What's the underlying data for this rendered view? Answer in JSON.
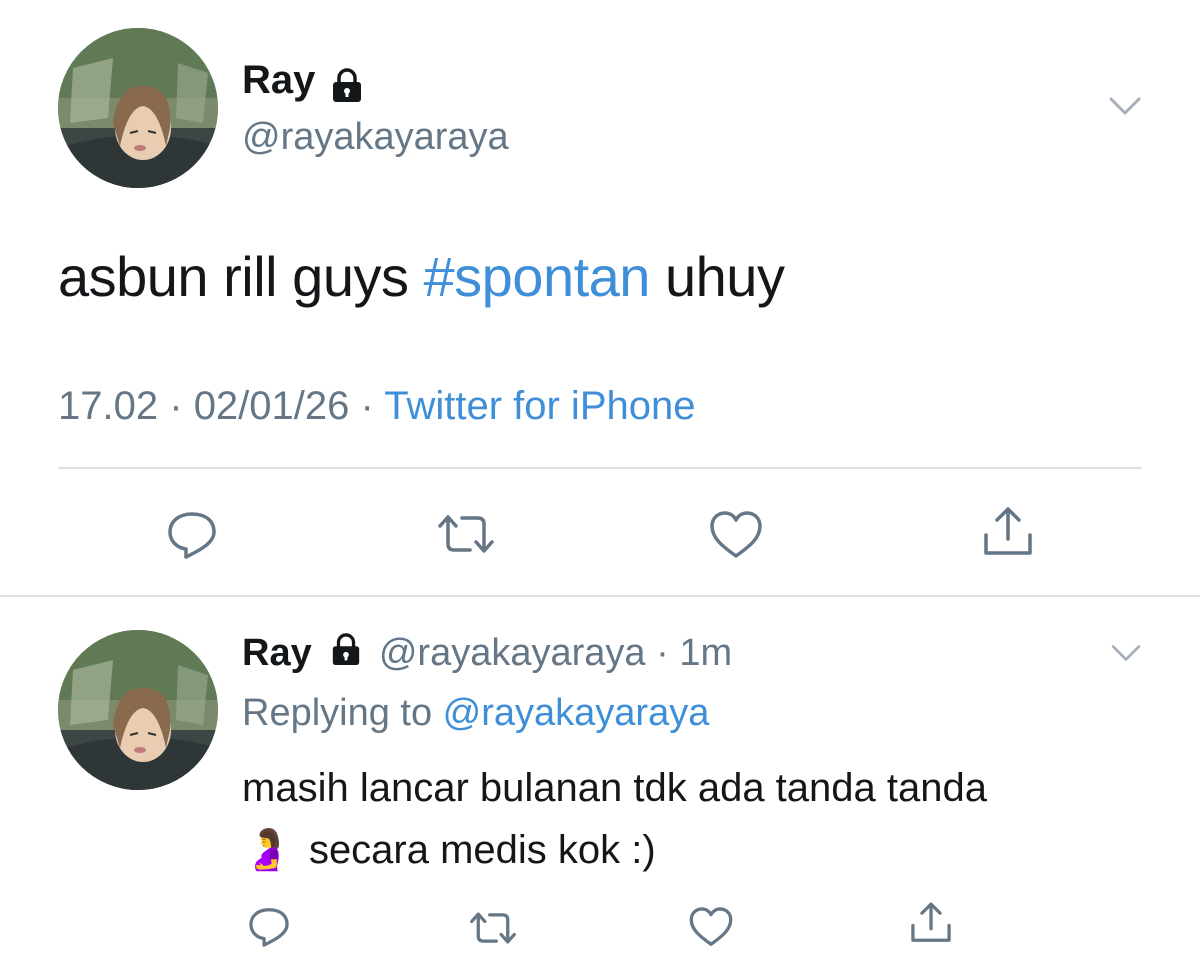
{
  "main_tweet": {
    "display_name": "Ray",
    "handle": "@rayakayaraya",
    "text_before": "asbun rill guys ",
    "hashtag": "#spontan",
    "text_after": " uhuy",
    "time": "17.02",
    "date": "02/01/26",
    "separator": "·",
    "client": "Twitter for iPhone"
  },
  "reply_tweet": {
    "display_name": "Ray",
    "handle": "@rayakayaraya",
    "separator": "·",
    "age": "1m",
    "replying_prefix": "Replying to ",
    "replying_handle": "@rayakayaraya",
    "line1": "masih lancar bulanan tdk ada tanda tanda",
    "emoji": "🤰",
    "line2": "secara medis kok :)"
  },
  "colors": {
    "link": "#3f8fd8",
    "text": "#14171a",
    "muted": "#657786",
    "icon": "#657786",
    "divider": "#dfe3e7"
  },
  "icons": [
    "lock-icon",
    "chevron-down-icon",
    "reply-icon",
    "retweet-icon",
    "like-icon",
    "share-icon"
  ]
}
